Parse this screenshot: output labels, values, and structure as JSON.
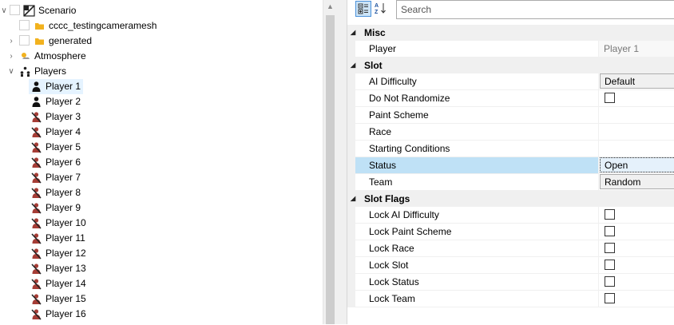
{
  "tree": {
    "scenario_label": "Scenario",
    "items": [
      {
        "label": "cccc_testingcameramesh",
        "icon": "folder-icon"
      },
      {
        "label": "generated",
        "icon": "folder-icon"
      },
      {
        "label": "Atmosphere",
        "icon": "atmosphere-icon"
      },
      {
        "label": "Players",
        "icon": "players-group-icon"
      }
    ],
    "players": [
      {
        "label": "Player 1",
        "icon": "human-player-icon"
      },
      {
        "label": "Player 2",
        "icon": "human-player-icon"
      },
      {
        "label": "Player 3",
        "icon": "crossed-player-icon"
      },
      {
        "label": "Player 4",
        "icon": "crossed-player-icon"
      },
      {
        "label": "Player 5",
        "icon": "crossed-player-icon"
      },
      {
        "label": "Player 6",
        "icon": "crossed-player-icon"
      },
      {
        "label": "Player 7",
        "icon": "crossed-player-icon"
      },
      {
        "label": "Player 8",
        "icon": "crossed-player-icon"
      },
      {
        "label": "Player 9",
        "icon": "crossed-player-icon"
      },
      {
        "label": "Player 10",
        "icon": "crossed-player-icon"
      },
      {
        "label": "Player 11",
        "icon": "crossed-player-icon"
      },
      {
        "label": "Player 12",
        "icon": "crossed-player-icon"
      },
      {
        "label": "Player 13",
        "icon": "crossed-player-icon"
      },
      {
        "label": "Player 14",
        "icon": "crossed-player-icon"
      },
      {
        "label": "Player 15",
        "icon": "crossed-player-icon"
      },
      {
        "label": "Player 16",
        "icon": "crossed-player-icon"
      }
    ]
  },
  "toolbar": {
    "search_placeholder": "Search",
    "categorized_icon": "categorized-view-icon",
    "alphabetical_icon": "sort-az-icon"
  },
  "categories": {
    "misc": "Misc",
    "slot": "Slot",
    "slot_flags": "Slot Flags"
  },
  "misc": {
    "player_name": "Player",
    "player_value": "Player 1"
  },
  "slot": {
    "ai_difficulty": "AI Difficulty",
    "ai_difficulty_value": "Default",
    "do_not_randomize": "Do Not Randomize",
    "paint_scheme": "Paint Scheme",
    "race": "Race",
    "starting_conditions": "Starting Conditions",
    "status": "Status",
    "status_value": "Open",
    "team": "Team",
    "team_value": "Random"
  },
  "slot_flags": {
    "lock_ai_difficulty": "Lock AI Difficulty",
    "lock_paint_scheme": "Lock Paint Scheme",
    "lock_race": "Lock Race",
    "lock_slot": "Lock Slot",
    "lock_status": "Lock Status",
    "lock_team": "Lock Team"
  },
  "colors": {
    "selection": "#e5f3ff",
    "highlight": "#bfe1f6",
    "category_bg": "#f0f0f0",
    "player_red": "#a63d36"
  }
}
